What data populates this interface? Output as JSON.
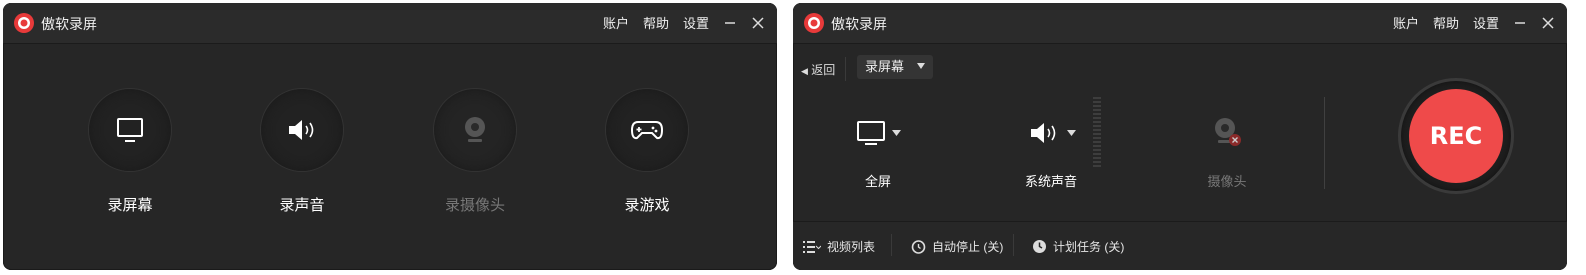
{
  "app": {
    "title": "傲软录屏",
    "menu_account": "账户",
    "menu_help": "帮助",
    "menu_settings": "设置"
  },
  "home": {
    "modes": [
      {
        "label": "录屏幕",
        "enabled": true,
        "icon": "monitor-icon"
      },
      {
        "label": "录声音",
        "enabled": true,
        "icon": "speaker-icon"
      },
      {
        "label": "录摄像头",
        "enabled": false,
        "icon": "webcam-icon"
      },
      {
        "label": "录游戏",
        "enabled": true,
        "icon": "gamepad-icon"
      }
    ]
  },
  "recorder": {
    "back_label": "返回",
    "mode_select": "录屏幕",
    "sources": [
      {
        "label": "全屏",
        "enabled": true,
        "icon": "monitor-icon"
      },
      {
        "label": "系统声音",
        "enabled": true,
        "icon": "speaker-icon"
      },
      {
        "label": "摄像头",
        "enabled": false,
        "icon": "webcam-off-icon"
      }
    ],
    "rec_label": "REC",
    "bottom": {
      "video_list": "视频列表",
      "auto_stop": "自动停止 (关)",
      "scheduled_task": "计划任务 (关)"
    }
  },
  "colors": {
    "background": "#262626",
    "rec": "#ef4a4a",
    "logo": "#e83a3a"
  }
}
